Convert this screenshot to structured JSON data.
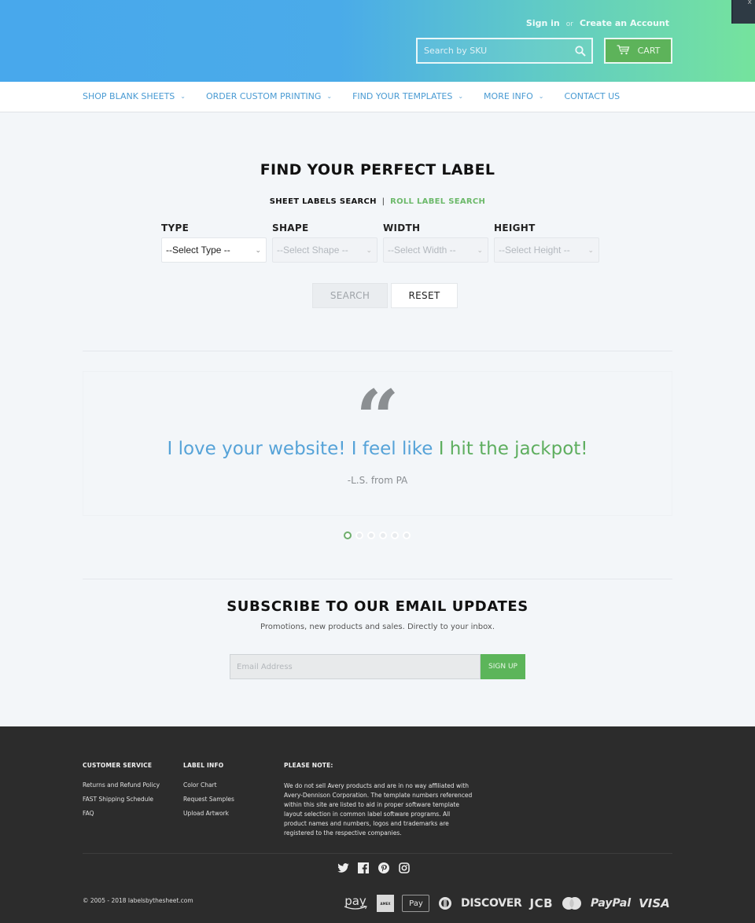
{
  "header": {
    "sign_in": "Sign in",
    "or": "or",
    "create_account": "Create an Account",
    "search_placeholder": "Search by SKU",
    "cart_label": "CART",
    "corner_glyph": "x",
    "gradient": [
      "#48a8ec",
      "#75e39d"
    ]
  },
  "nav": {
    "items": [
      {
        "label": "SHOP BLANK SHEETS",
        "dropdown": true
      },
      {
        "label": "ORDER CUSTOM PRINTING",
        "dropdown": true
      },
      {
        "label": "FIND YOUR TEMPLATES",
        "dropdown": true
      },
      {
        "label": "MORE INFO",
        "dropdown": true
      },
      {
        "label": "CONTACT US",
        "dropdown": false
      }
    ],
    "chevron": "⌄"
  },
  "finder": {
    "title": "FIND YOUR PERFECT LABEL",
    "tab_sheet": "SHEET LABELS SEARCH",
    "tab_separator": "|",
    "tab_roll": "ROLL LABEL SEARCH",
    "fields": [
      {
        "label": "TYPE",
        "value": "--Select Type --",
        "enabled": true
      },
      {
        "label": "SHAPE",
        "value": "--Select Shape --",
        "enabled": false
      },
      {
        "label": "WIDTH",
        "value": "--Select Width --",
        "enabled": false
      },
      {
        "label": "HEIGHT",
        "value": "--Select Height --",
        "enabled": false
      }
    ],
    "caret": "⌄",
    "search_label": "SEARCH",
    "reset_label": "RESET"
  },
  "testimonial": {
    "quote_mark": "“",
    "text_blue": "I love your website! I feel like ",
    "text_green": "I hit the jackpot!",
    "author": "-L.S. from PA",
    "slide_count": 6,
    "active_slide": 1
  },
  "subscribe": {
    "title": "SUBSCRIBE TO OUR EMAIL UPDATES",
    "subtitle": "Promotions, new products and sales. Directly to your inbox.",
    "email_placeholder": "Email Address",
    "button_label": "SIGN UP"
  },
  "footer": {
    "customer_service": {
      "heading": "CUSTOMER SERVICE",
      "links": [
        "Returns and Refund Policy",
        "FAST Shipping Schedule",
        "FAQ"
      ]
    },
    "label_info": {
      "heading": "LABEL INFO",
      "links": [
        "Color Chart",
        "Request Samples",
        "Upload Artwork"
      ]
    },
    "note": {
      "heading": "PLEASE NOTE:",
      "text": "We do not sell Avery products and are in no way affiliated with Avery-Dennison Corporation. The template numbers referenced within this site are listed to aid in proper software template layout selection in common label software programs. All product names and numbers, logos and trademarks are registered to the respective companies."
    },
    "social": [
      "twitter-icon",
      "facebook-icon",
      "pinterest-icon",
      "instagram-icon"
    ],
    "copyright": "© 2005 - 2018 labelsbythesheet.com",
    "payments": {
      "amazon_pay": "pay",
      "amex": "AMEX",
      "apple_pay": "Pay",
      "diners": "Diners Club",
      "discover": "DISCOVER",
      "jcb": "JCB",
      "mastercard": "MasterCard",
      "paypal": "PayPal",
      "visa": "VISA"
    }
  }
}
